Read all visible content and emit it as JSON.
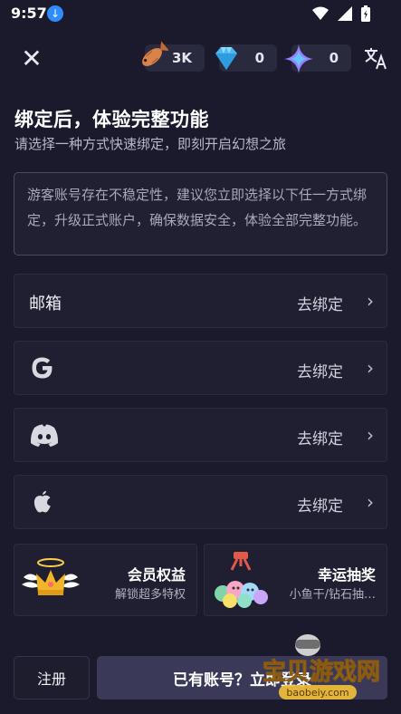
{
  "status_bar": {
    "time": "9:57"
  },
  "currencies": [
    {
      "icon": "fish-icon",
      "value": "3K"
    },
    {
      "icon": "diamond-icon",
      "value": "0"
    },
    {
      "icon": "star-icon",
      "value": "0"
    }
  ],
  "header": {
    "title": "绑定后，体验完整功能",
    "subtitle": "请选择一种方式快速绑定，即刻开启幻想之旅"
  },
  "notice": "游客账号存在不稳定性，建议您立即选择以下任一方式绑定，升级正式账户，确保数据安全，体验全部完整功能。",
  "bind_options": [
    {
      "label": "邮箱",
      "icon": "",
      "action": "去绑定"
    },
    {
      "label": "",
      "icon": "google-icon",
      "action": "去绑定"
    },
    {
      "label": "",
      "icon": "discord-icon",
      "action": "去绑定"
    },
    {
      "label": "",
      "icon": "apple-icon",
      "action": "去绑定"
    }
  ],
  "cards": [
    {
      "title": "会员权益",
      "subtitle": "解锁超多特权"
    },
    {
      "title": "幸运抽奖",
      "subtitle": "小鱼干/钻石抽…"
    }
  ],
  "buttons": {
    "register": "注册",
    "login": "已有账号？立即登录"
  },
  "watermark": {
    "text": "宝贝游戏网",
    "url": "baobeiy.com"
  },
  "colors": {
    "background": "#1a1a2c",
    "row_bg": "#1f1f31",
    "login_btn": "#3a3a58"
  }
}
